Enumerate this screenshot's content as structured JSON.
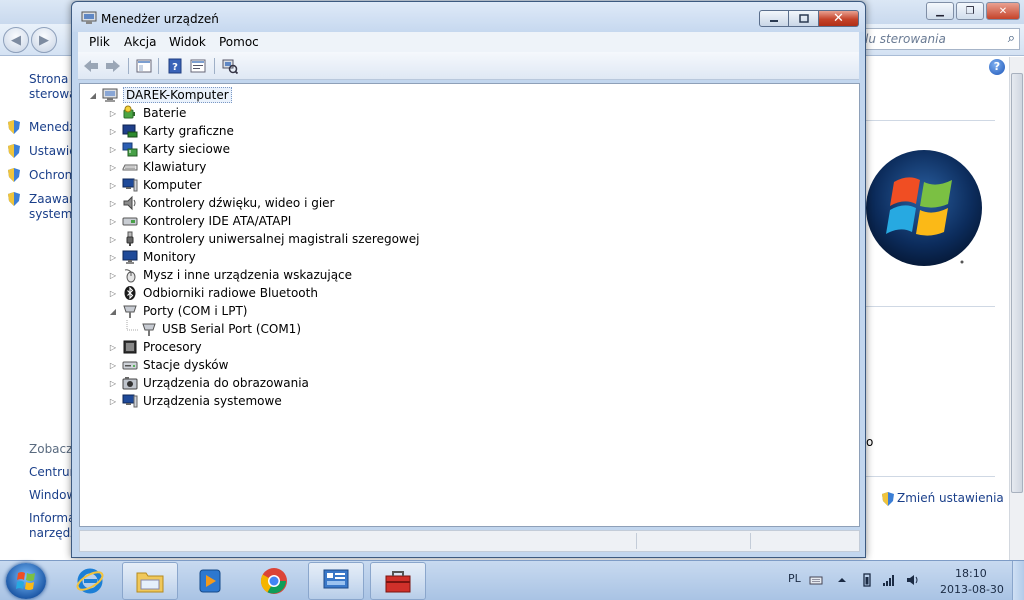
{
  "background_window": {
    "search_placeholder": "lu sterowania",
    "sidebar_top": [
      "Strona g",
      "sterowa"
    ],
    "sidebar_links": [
      "Menedż",
      "Ustawie",
      "Ochrona",
      "Zaawan",
      "systemu"
    ],
    "see_also": {
      "heading": "Zobacz",
      "links": [
        "Centrun",
        "Window",
        "Informa",
        "narzędzi"
      ]
    },
    "right_fragment": "o",
    "change_settings_link": "Zmień ustawienia"
  },
  "device_manager": {
    "title": "Menedżer urządzeń",
    "menu": [
      "Plik",
      "Akcja",
      "Widok",
      "Pomoc"
    ],
    "tree": {
      "root": "DAREK-Komputer",
      "items": [
        {
          "label": "Baterie",
          "icon": "battery-icon",
          "expanded": false
        },
        {
          "label": "Karty graficzne",
          "icon": "display-adapter-icon",
          "expanded": false
        },
        {
          "label": "Karty sieciowe",
          "icon": "network-adapter-icon",
          "expanded": false
        },
        {
          "label": "Klawiatury",
          "icon": "keyboard-icon",
          "expanded": false
        },
        {
          "label": "Komputer",
          "icon": "computer-icon",
          "expanded": false
        },
        {
          "label": "Kontrolery dźwięku, wideo i gier",
          "icon": "speaker-icon",
          "expanded": false
        },
        {
          "label": "Kontrolery IDE ATA/ATAPI",
          "icon": "ide-controller-icon",
          "expanded": false
        },
        {
          "label": "Kontrolery uniwersalnej magistrali szeregowej",
          "icon": "usb-icon",
          "expanded": false
        },
        {
          "label": "Monitory",
          "icon": "monitor-icon",
          "expanded": false
        },
        {
          "label": "Mysz i inne urządzenia wskazujące",
          "icon": "mouse-icon",
          "expanded": false
        },
        {
          "label": "Odbiorniki radiowe Bluetooth",
          "icon": "bluetooth-icon",
          "expanded": false
        },
        {
          "label": "Porty (COM i LPT)",
          "icon": "port-icon",
          "expanded": true,
          "children": [
            "USB Serial Port (COM1)"
          ]
        },
        {
          "label": "Procesory",
          "icon": "processor-icon",
          "expanded": false
        },
        {
          "label": "Stacje dysków",
          "icon": "disk-drive-icon",
          "expanded": false
        },
        {
          "label": "Urządzenia do obrazowania",
          "icon": "camera-icon",
          "expanded": false
        },
        {
          "label": "Urządzenia systemowe",
          "icon": "system-devices-icon",
          "expanded": false
        }
      ]
    }
  },
  "taskbar": {
    "language": "PL",
    "time": "18:10",
    "date": "2013-08-30"
  }
}
